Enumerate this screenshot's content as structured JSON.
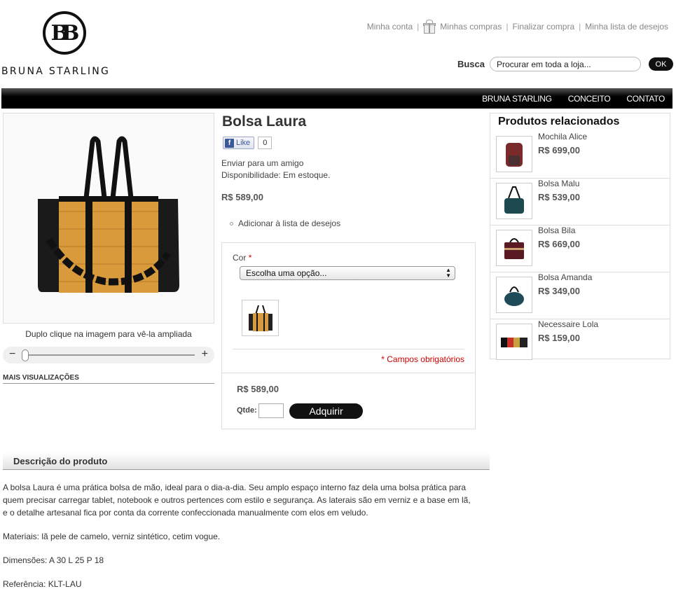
{
  "brand": {
    "logo_mark": "BB",
    "name": "BRUNA STARLING"
  },
  "toplinks": {
    "account": "Minha conta",
    "purchases": "Minhas compras",
    "checkout": "Finalizar compra",
    "wishlist": "Minha lista de desejos"
  },
  "search": {
    "label": "Busca",
    "placeholder": "Procurar em toda a loja...",
    "button": "OK"
  },
  "nav": {
    "items": [
      "BRUNA STARLING",
      "CONCEITO",
      "CONTATO"
    ]
  },
  "gallery": {
    "hint": "Duplo clique na imagem para vê-la ampliada",
    "zoom_minus": "−",
    "zoom_plus": "+",
    "zoom_level": 0,
    "more_views": "MAIS VISUALIZAÇÕES"
  },
  "product": {
    "name": "Bolsa Laura",
    "fb_like": "Like",
    "fb_count": "0",
    "email_friend": "Enviar para um amigo",
    "availability": "Disponibilidade: Em estoque.",
    "price": "R$ 589,00",
    "add_wishlist": "Adicionar à lista de desejos"
  },
  "options": {
    "color_label": "Cor",
    "required_mark": "*",
    "select_value": "Escolha uma opção...",
    "required_note": "* Campos obrigatórios",
    "price": "R$ 589,00",
    "qty_label": "Qtde:",
    "qty_value": "",
    "buy_button": "Adquirir"
  },
  "related": {
    "title": "Produtos relacionados",
    "items": [
      {
        "name": "Mochila Alice",
        "price": "R$ 699,00",
        "color": "#7a2a2a"
      },
      {
        "name": "Bolsa Malu",
        "price": "R$ 539,00",
        "color": "#1c4a4f"
      },
      {
        "name": "Bolsa Bila",
        "price": "R$ 669,00",
        "color": "#5a1a24"
      },
      {
        "name": "Bolsa Amanda",
        "price": "R$ 349,00",
        "color": "#1f4a58"
      },
      {
        "name": "Necessaire Lola",
        "price": "R$ 159,00",
        "color": "#c8a040"
      }
    ]
  },
  "description": {
    "title": "Descrição do produto",
    "paragraphs": [
      "A bolsa Laura é uma prática bolsa de mão, ideal para o dia-a-dia. Seu amplo espaço interno faz dela uma bolsa prática para quem precisar carregar tablet, notebook e outros pertences com estilo e segurança. As laterais são em verniz e a base em lã, e o detalhe artesanal fica por conta da corrente confeccionada manualmente com elos em veludo.",
      "Materiais: lã pele de camelo, verniz sintético, cetim vogue.",
      "Dimensões: A 30 L 25 P 18",
      "Referência: KLT-LAU"
    ]
  }
}
